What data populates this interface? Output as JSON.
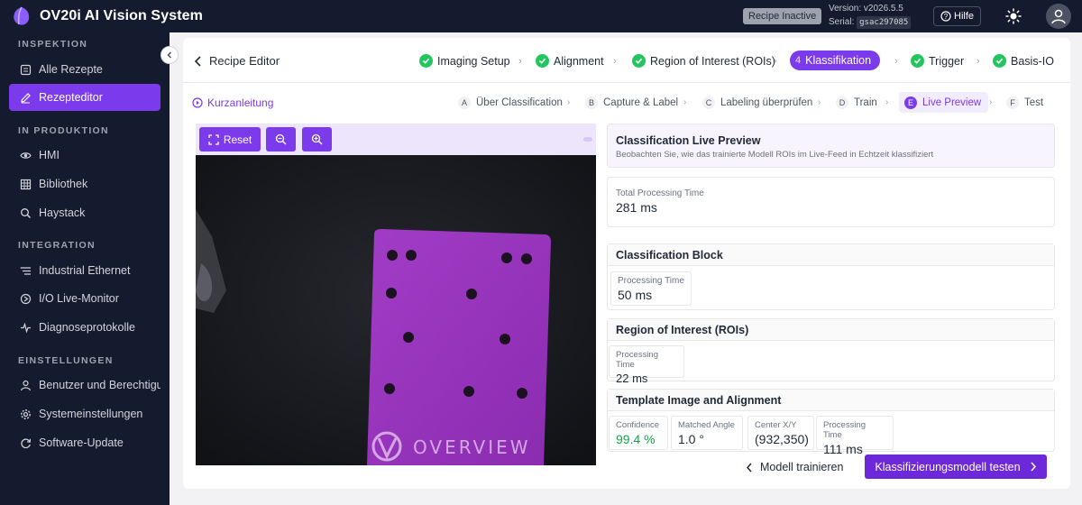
{
  "app": {
    "title": "OV20i AI Vision System",
    "recipe_status": "Recipe Inactive",
    "version": "Version: v2026.5.5",
    "serial_label": "Serial:",
    "serial_code": "gsac297085",
    "help_label": "Hilfe"
  },
  "sidebar": {
    "sections": [
      {
        "label": "INSPEKTION",
        "items": [
          {
            "label": "Alle Rezepte",
            "icon": "list-icon"
          },
          {
            "label": "Rezepteditor",
            "icon": "edit-icon",
            "active": true
          }
        ]
      },
      {
        "label": "IN PRODUKTION",
        "items": [
          {
            "label": "HMI",
            "icon": "eye-icon"
          },
          {
            "label": "Bibliothek",
            "icon": "grid-icon"
          },
          {
            "label": "Haystack",
            "icon": "search-icon"
          }
        ]
      },
      {
        "label": "INTEGRATION",
        "items": [
          {
            "label": "Industrial Ethernet",
            "icon": "network-icon"
          },
          {
            "label": "I/O Live-Monitor",
            "icon": "io-icon"
          },
          {
            "label": "Diagnoseprotokolle",
            "icon": "log-icon"
          }
        ]
      },
      {
        "label": "EINSTELLUNGEN",
        "items": [
          {
            "label": "Benutzer und Berechtigungen",
            "icon": "user-icon"
          },
          {
            "label": "Systemeinstellungen",
            "icon": "gear-icon"
          },
          {
            "label": "Software-Update",
            "icon": "refresh-icon"
          }
        ]
      }
    ]
  },
  "editor": {
    "back_label": "Recipe Editor",
    "steps": [
      {
        "label": "Imaging Setup",
        "status": "done"
      },
      {
        "label": "Alignment",
        "status": "done"
      },
      {
        "label": "Region of Interest (ROIs)",
        "status": "done"
      },
      {
        "label": "Klassifikation",
        "number": "4",
        "status": "current"
      },
      {
        "label": "Trigger",
        "status": "done"
      },
      {
        "label": "Basis-IO",
        "status": "done"
      }
    ],
    "guide_label": "Kurzanleitung",
    "substeps": [
      {
        "letter": "A",
        "label": "Über Classification"
      },
      {
        "letter": "B",
        "label": "Capture & Label"
      },
      {
        "letter": "C",
        "label": "Labeling überprüfen"
      },
      {
        "letter": "D",
        "label": "Train"
      },
      {
        "letter": "E",
        "label": "Live Preview",
        "current": true
      },
      {
        "letter": "F",
        "label": "Test"
      }
    ]
  },
  "viewer": {
    "reset_label": "Reset",
    "part_text": "OVERVIEW"
  },
  "preview": {
    "title": "Classification Live Preview",
    "subtitle": "Beobachten Sie, wie das trainierte Modell ROIs im Live-Feed in Echtzeit klassifiziert",
    "total_label": "Total Processing Time",
    "total_value": "281 ms",
    "classification_block": {
      "title": "Classification Block",
      "label": "Processing Time",
      "value": "50 ms"
    },
    "roi_block": {
      "title": "Region of Interest (ROIs)",
      "label": "Processing Time",
      "value": "22 ms"
    },
    "template_block": {
      "title": "Template Image and Alignment",
      "stats": [
        {
          "label": "Confidence",
          "value": "99.4 %",
          "highlight": true
        },
        {
          "label": "Matched Angle",
          "value": "1.0 °"
        },
        {
          "label": "Center X/Y",
          "value": "(932,350)"
        },
        {
          "label": "Processing Time",
          "value": "111 ms"
        }
      ]
    }
  },
  "footer": {
    "back_label": "Modell trainieren",
    "next_label": "Klassifizierungsmodell testen"
  },
  "colors": {
    "accent": "#7c3aed",
    "sidebar_bg": "#141b2e",
    "success": "#22c55e",
    "confidence_text": "#16a34a"
  }
}
